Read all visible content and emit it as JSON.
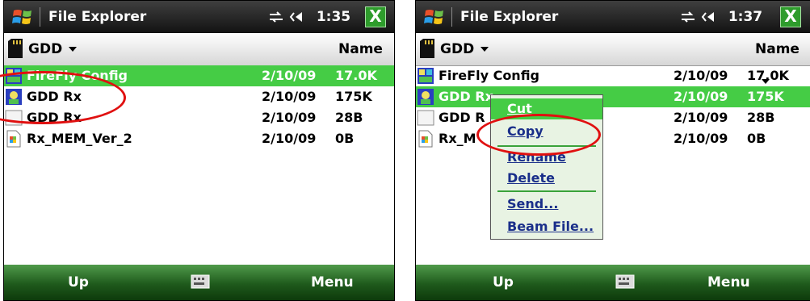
{
  "icons": {
    "start": "windows-flag-icon",
    "connectivity": "sync-arrows-icon",
    "volume": "speaker-icon",
    "close": "close-icon",
    "storage": "sd-card-icon",
    "keyboard": "keyboard-icon"
  },
  "colors": {
    "selection": "#45cc45",
    "menu_background": "#e8f3e3",
    "menu_text": "#1a2f8a",
    "annotation": "#e01010"
  },
  "left_screen": {
    "title": "File Explorer",
    "clock": "1:35",
    "close_label": "X",
    "folder": "GDD",
    "sort_label": "Name",
    "files": [
      {
        "name": "FireFly Config",
        "date": "2/10/09",
        "size": "17.0K",
        "icon": "config-app-icon",
        "selected": true
      },
      {
        "name": "GDD Rx",
        "date": "2/10/09",
        "size": "175K",
        "icon": "app-icon",
        "selected": false
      },
      {
        "name": "GDD Rx",
        "date": "2/10/09",
        "size": "28B",
        "icon": "blank-file-icon",
        "selected": false
      },
      {
        "name": "Rx_MEM_Ver_2",
        "date": "2/10/09",
        "size": "0B",
        "icon": "document-icon",
        "selected": false
      }
    ],
    "softkeys": {
      "left": "Up",
      "right": "Menu"
    }
  },
  "right_screen": {
    "title": "File Explorer",
    "clock": "1:37",
    "close_label": "X",
    "folder": "GDD",
    "sort_label": "Name",
    "files": [
      {
        "name": "FireFly Config",
        "date": "2/10/09",
        "size": "17.0K",
        "icon": "config-app-icon",
        "selected": false
      },
      {
        "name": "GDD Rx",
        "date": "2/10/09",
        "size": "175K",
        "icon": "app-icon",
        "selected": true
      },
      {
        "name": "GDD R",
        "date": "2/10/09",
        "size": "28B",
        "icon": "blank-file-icon",
        "selected": false
      },
      {
        "name": "Rx_M",
        "date": "2/10/09",
        "size": "0B",
        "icon": "document-icon",
        "selected": false
      }
    ],
    "softkeys": {
      "left": "Up",
      "right": "Menu"
    },
    "context_menu": [
      "Cut",
      "Copy",
      "Rename",
      "Delete",
      "Send...",
      "Beam File..."
    ]
  }
}
